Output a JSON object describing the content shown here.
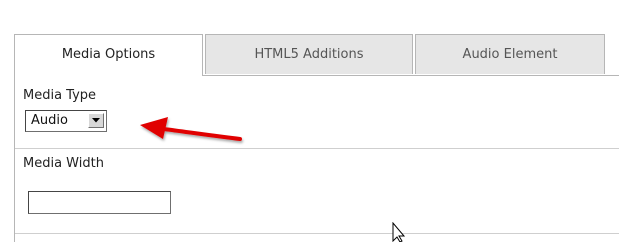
{
  "tabs": [
    {
      "label": "Media Options",
      "active": true
    },
    {
      "label": "HTML5 Additions",
      "active": false
    },
    {
      "label": "Audio Element",
      "active": false
    }
  ],
  "media_type": {
    "label": "Media Type",
    "selected": "Audio"
  },
  "media_width": {
    "label": "Media Width",
    "value": ""
  },
  "icons": {
    "dropdown": "chevron-down-icon",
    "annotation": "red-arrow-icon",
    "pointer": "mouse-cursor-icon"
  },
  "colors": {
    "annotation_arrow": "#e00000"
  }
}
